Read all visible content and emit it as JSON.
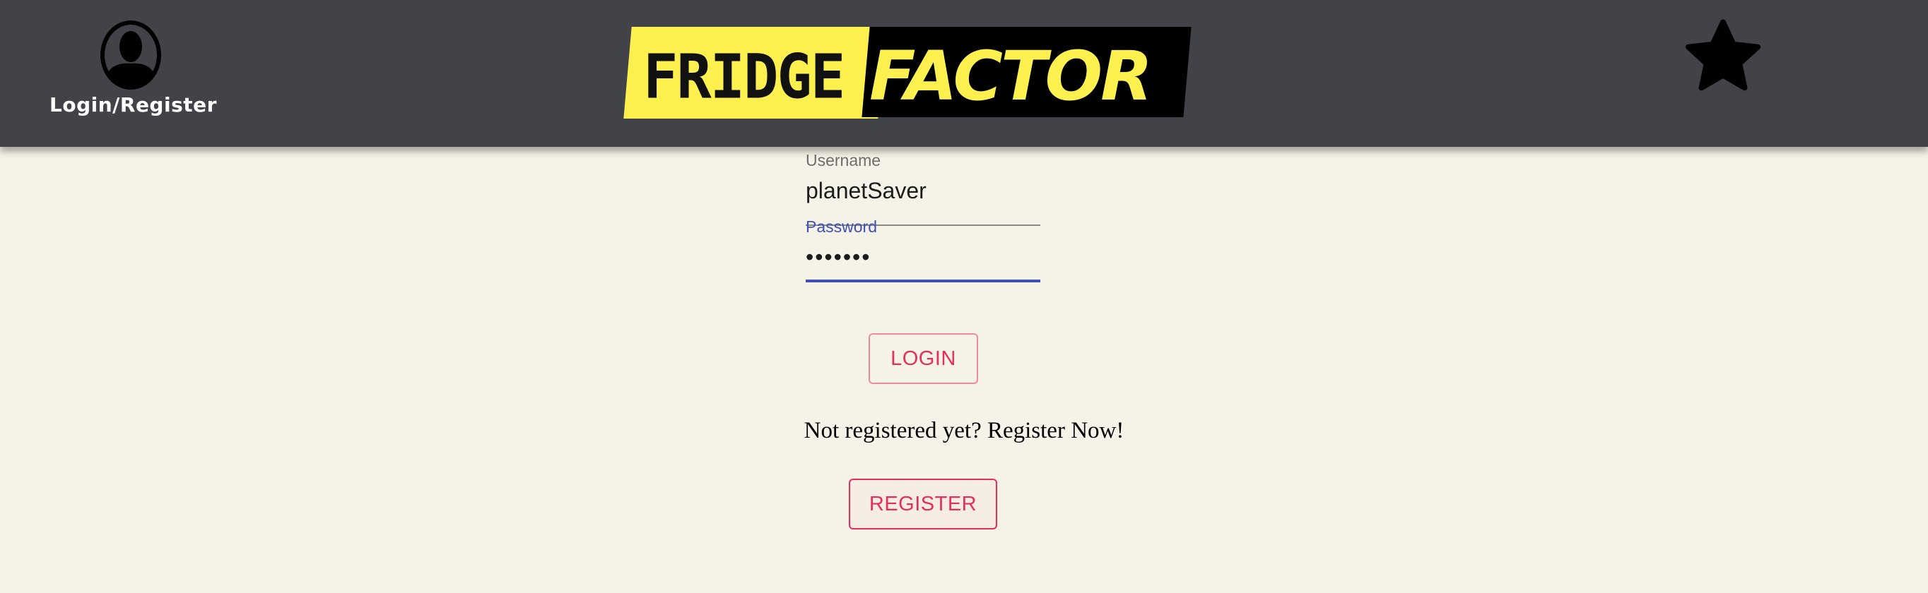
{
  "header": {
    "user_label": "Login/Register",
    "logo_text_left": "FRIDGE",
    "logo_text_right": "FACTOR",
    "icons": [
      "user-avatar-icon",
      "star-icon"
    ]
  },
  "form": {
    "username_label": "Username",
    "username_value": "planetSaver",
    "password_label": "Password",
    "password_value": "•••••••",
    "login_label": "LOGIN",
    "register_prompt": "Not registered yet? Register Now!",
    "register_label": "REGISTER"
  },
  "colors": {
    "header": "#424349",
    "background": "#f5f2e7",
    "accent": "#e3305a",
    "focus": "#3f51b5",
    "logo_yellow": "#fdf04f"
  }
}
